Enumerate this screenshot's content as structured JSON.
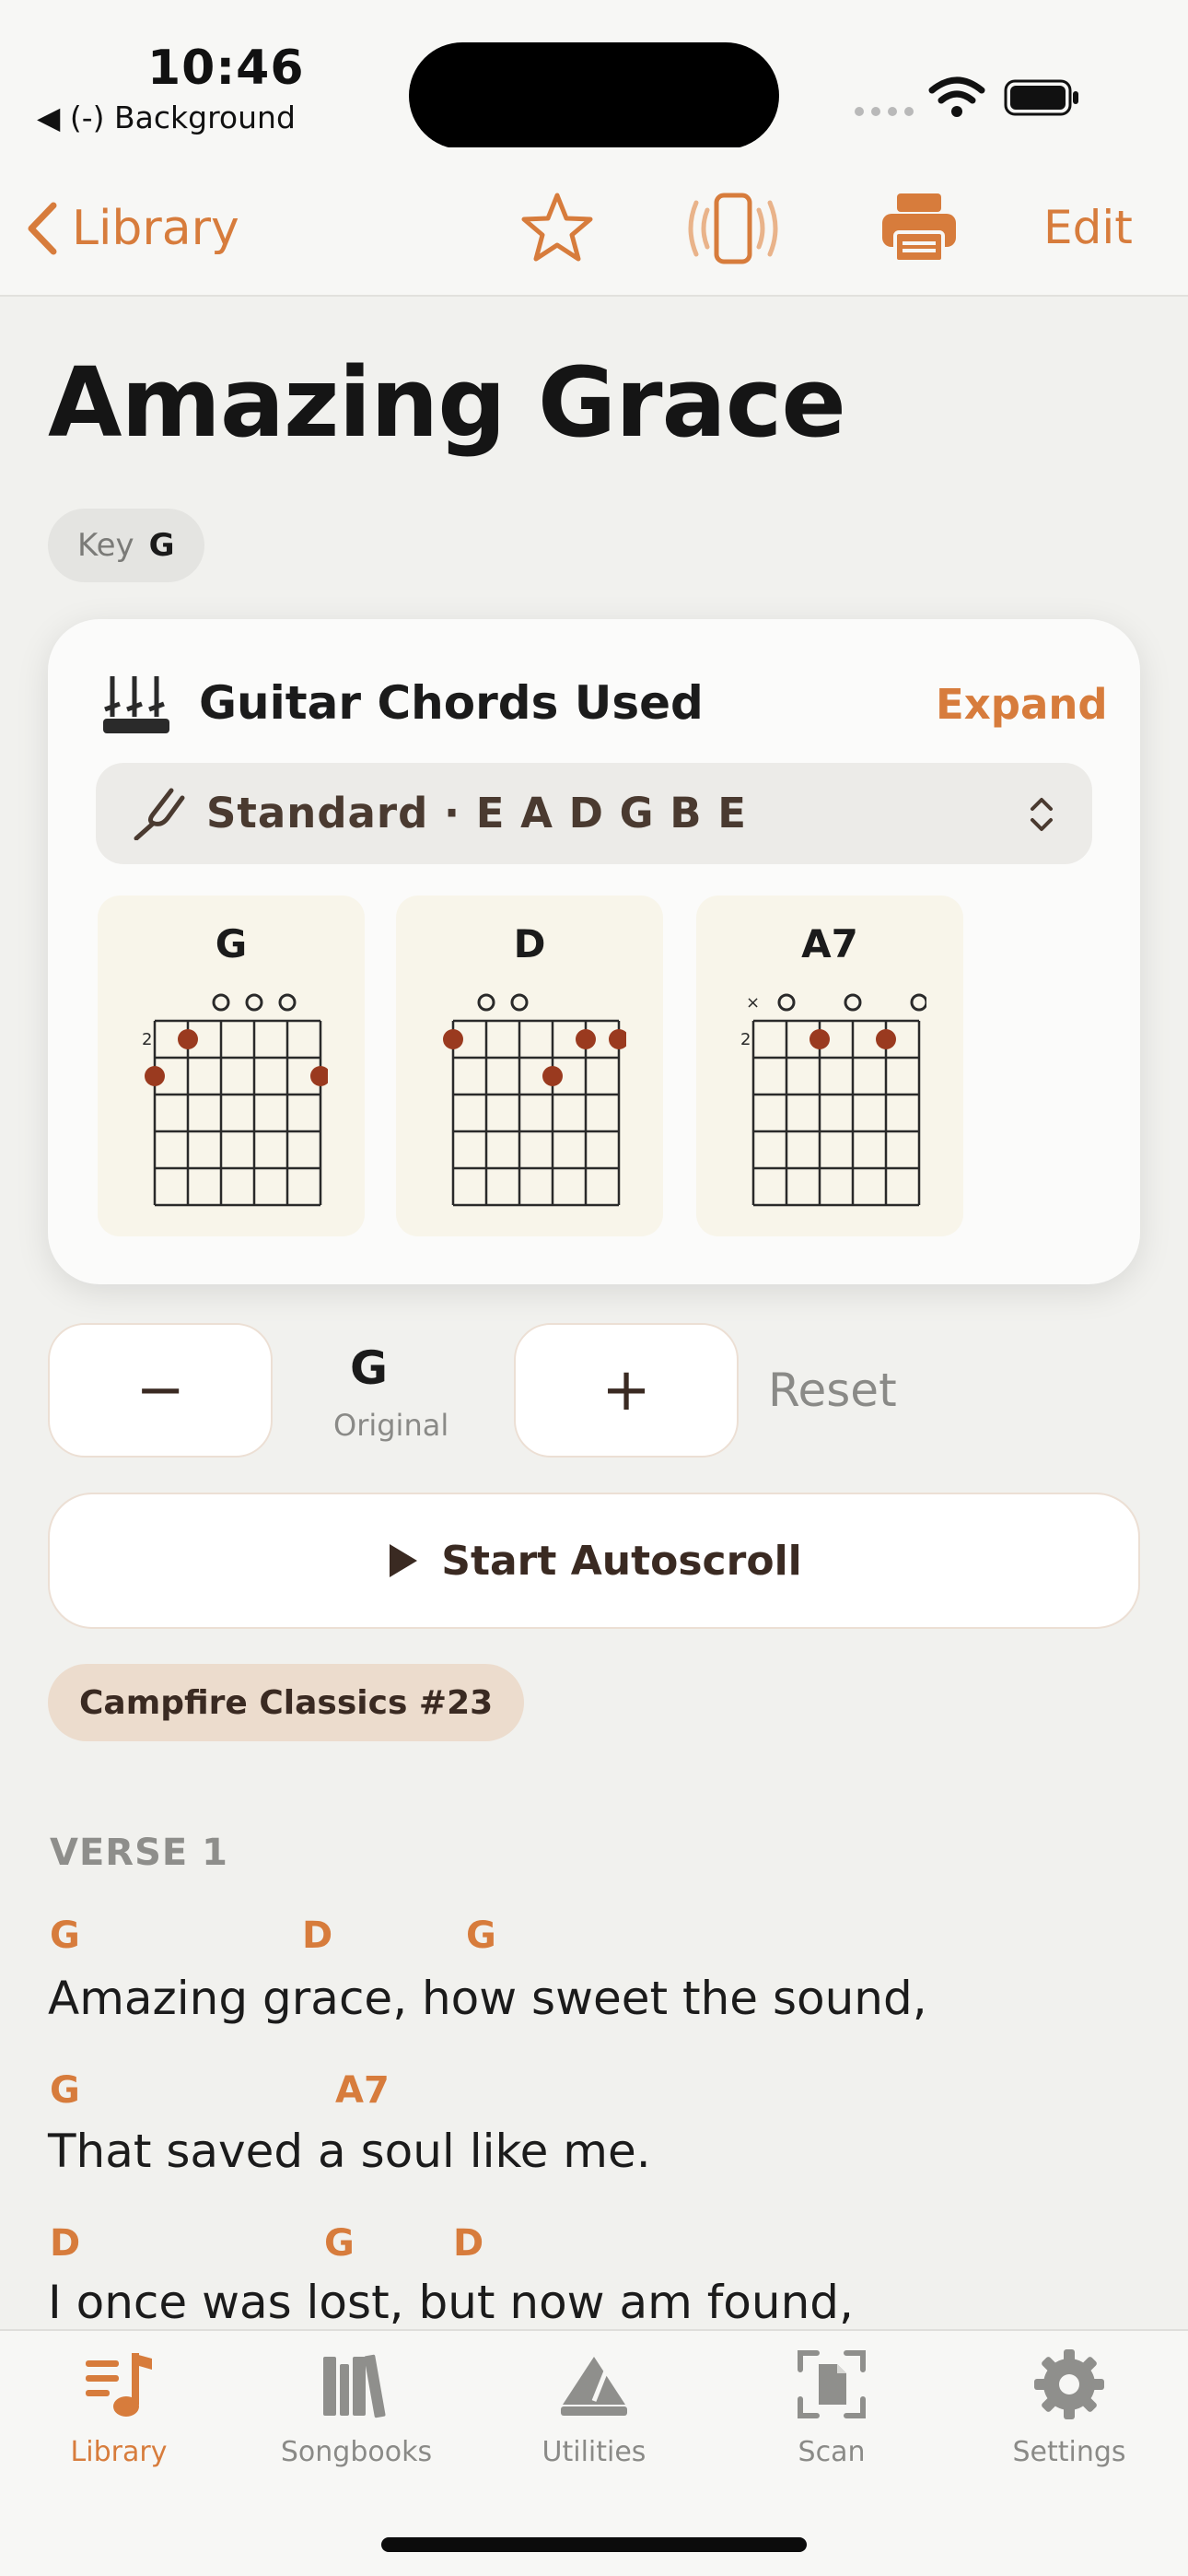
{
  "status_bar": {
    "time": "10:46",
    "back_app": "◀ (-) Background"
  },
  "nav": {
    "back_label": "Library",
    "edit_label": "Edit"
  },
  "song": {
    "title": "Amazing Grace",
    "key_label": "Key",
    "key_value": "G"
  },
  "chords_card": {
    "title": "Guitar Chords Used",
    "expand_label": "Expand",
    "tuning": "Standard · E A D G B E",
    "chords": [
      {
        "name": "G"
      },
      {
        "name": "D"
      },
      {
        "name": "A7"
      }
    ]
  },
  "transpose": {
    "minus_label": "−",
    "plus_label": "+",
    "current_key": "G",
    "current_sub": "Original",
    "reset_label": "Reset"
  },
  "autoscroll": {
    "label": "Start Autoscroll"
  },
  "songbook_tag": "Campfire Classics #23",
  "lyrics": {
    "section": "VERSE 1",
    "lines": [
      {
        "chords": [
          "G",
          "D",
          "G"
        ],
        "text": "Amazing grace, how sweet the sound,"
      },
      {
        "chords": [
          "G",
          "A7"
        ],
        "text": "That saved a soul like me."
      },
      {
        "chords": [
          "D",
          "G",
          "D"
        ],
        "text": "I once was lost, but now am found,"
      }
    ]
  },
  "tabs": [
    {
      "label": "Library",
      "icon": "music-list-icon",
      "active": true
    },
    {
      "label": "Songbooks",
      "icon": "books-icon",
      "active": false
    },
    {
      "label": "Utilities",
      "icon": "utilities-icon",
      "active": false
    },
    {
      "label": "Scan",
      "icon": "scan-icon",
      "active": false
    },
    {
      "label": "Settings",
      "icon": "gear-icon",
      "active": false
    }
  ],
  "colors": {
    "accent": "#d77c3c",
    "dot": "#9a3a1f",
    "background": "#f1f1ee"
  }
}
